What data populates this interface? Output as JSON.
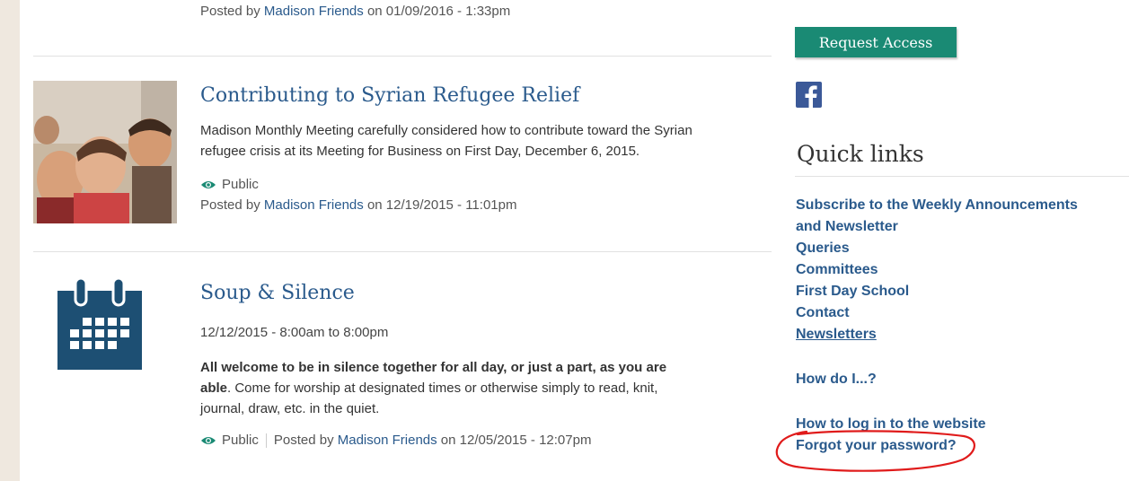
{
  "articles": [
    {
      "posted_prefix": "Posted by ",
      "author": "Madison Friends",
      "posted_suffix": " on 01/09/2016 - 1:33pm"
    },
    {
      "title": "Contributing to Syrian Refugee Relief",
      "body_line1": "Madison Monthly Meeting carefully considered how to contribute toward the Syrian",
      "body_line2": "refugee crisis at its Meeting for Business on First Day, December 6, 2015.",
      "visibility": "Public",
      "posted_prefix": "Posted by ",
      "author": "Madison Friends",
      "posted_suffix": " on 12/19/2015 - 11:01pm"
    },
    {
      "title": "Soup & Silence",
      "date": "12/12/2015 - 8:00am to 8:00pm",
      "bold_line1": "All welcome to be in silence together for all day, or just a part, as you are",
      "bold_line2": "able",
      "body_line2_rest": ". Come for worship at designated times or otherwise simply to read, knit,",
      "body_line3": "journal, draw, etc. in the quiet.",
      "visibility": "Public",
      "posted_prefix": "Posted by ",
      "author": "Madison Friends",
      "posted_suffix": " on 12/05/2015 - 12:07pm"
    }
  ],
  "sidebar": {
    "request_access": "Request Access",
    "quick_links_title": "Quick links",
    "links": [
      "Subscribe to the Weekly Announcements",
      "and Newsletter",
      "Queries",
      "Committees",
      "First Day School",
      "Contact",
      "Newsletters"
    ],
    "how_do_i": "How do I...?",
    "how_to_login": "How to log in to the website",
    "forgot_password": "Forgot your password?"
  },
  "colors": {
    "link": "#2a5a8c",
    "button": "#1a8a74",
    "facebook": "#3b5998",
    "calendar": "#1d4f73",
    "annotation": "#e01b1b"
  }
}
